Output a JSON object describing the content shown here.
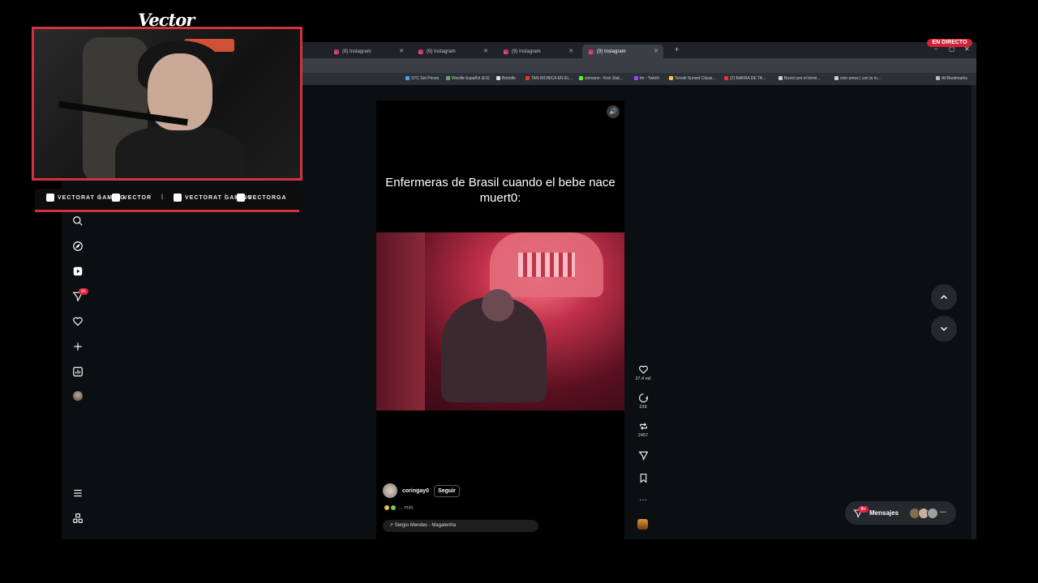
{
  "overlay": {
    "streamer_name": "Vector",
    "socials": [
      {
        "icon": "youtube-icon",
        "label": "VECTORAT GAMING"
      },
      {
        "icon": "twitch-icon",
        "label": "VECTOR"
      },
      {
        "icon": "twitter-icon",
        "label": "VECTORAT GAMING"
      },
      {
        "icon": "instagram-icon",
        "label": "VECTORGA"
      }
    ],
    "live_badge": "EN DIRECTO"
  },
  "browser": {
    "tabs": [
      {
        "label": "(9) Instagram",
        "active": false
      },
      {
        "label": "(9) Instagram",
        "active": false
      },
      {
        "label": "(9) Instagram",
        "active": false
      },
      {
        "label": "(9) Instagram",
        "active": true
      }
    ],
    "bookmarks": [
      "STC Set Prices",
      "Wordle Español (ES)",
      "Botodle",
      "TAN BIONICA EN EL...",
      "sixmann - Kick Stat...",
      "tm - Twitch",
      "Tenoki Sunset Classi...",
      "(2) BARRA DE TA...",
      "Buscó por el térmi...",
      "cion amos | con la m...",
      "All Bookmarks"
    ]
  },
  "sidebar": {
    "items": [
      "search-icon",
      "explore-icon",
      "reels-icon",
      "messages-icon",
      "notifications-icon",
      "create-icon",
      "dashboard-icon",
      "profile-avatar"
    ],
    "messages_badge": "9+",
    "bottom": [
      "menu-icon",
      "threads-icon"
    ]
  },
  "reel": {
    "caption": "Enfermeras de Brasil cuando el bebe nace muert0:",
    "author": "coringay0",
    "follow_label": "Seguir",
    "description_more": "... más",
    "audio": "Sergio Mendes - Magalenha",
    "likes": "27,4 mil",
    "comments": "229",
    "reposts": "2457"
  },
  "messages": {
    "label": "Mensajes",
    "badge": "9+"
  }
}
